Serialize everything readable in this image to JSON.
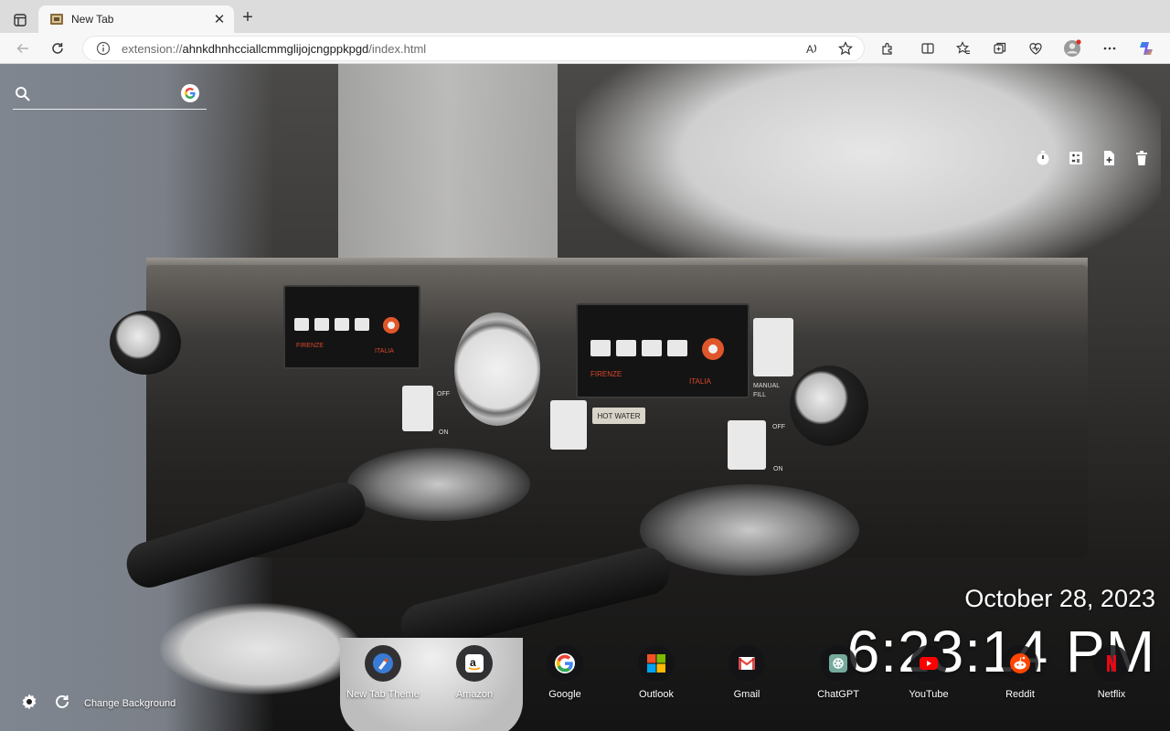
{
  "browser": {
    "tab": {
      "title": "New Tab",
      "close_glyph": "✕",
      "favicon": "newtab-theme-favicon"
    },
    "new_tab_glyph": "+",
    "address": {
      "scheme": "extension://",
      "host": "ahnkdhnhcciallcmmglijojcngppkpgd",
      "path": "/index.html"
    },
    "toolbar_icons": [
      "back-icon",
      "reload-icon",
      "site-info-icon",
      "read-aloud-icon",
      "favorite-star-icon",
      "extensions-icon",
      "split-screen-icon",
      "favorites-icon",
      "collections-icon",
      "browser-essentials-icon",
      "profile-avatar",
      "more-icon",
      "copilot-icon"
    ],
    "accent": "#0b57d0"
  },
  "search": {
    "placeholder": "",
    "value": "",
    "engine": "google-icon"
  },
  "top_tools": [
    "timer-icon",
    "calculator-icon",
    "new-note-icon",
    "trash-icon"
  ],
  "clock": {
    "date": "October 28, 2023",
    "time": "6:23:14 PM"
  },
  "shortcuts": [
    {
      "label": "New Tab Theme",
      "icon": "new-tab-theme-icon"
    },
    {
      "label": "Amazon",
      "icon": "amazon-icon"
    },
    {
      "label": "Google",
      "icon": "google-icon"
    },
    {
      "label": "Outlook",
      "icon": "outlook-icon"
    },
    {
      "label": "Gmail",
      "icon": "gmail-icon"
    },
    {
      "label": "ChatGPT",
      "icon": "chatgpt-icon"
    },
    {
      "label": "YouTube",
      "icon": "youtube-icon"
    },
    {
      "label": "Reddit",
      "icon": "reddit-icon"
    },
    {
      "label": "Netflix",
      "icon": "netflix-icon"
    }
  ],
  "footer": {
    "change_background": "Change Background",
    "icons": [
      "settings-icon",
      "refresh-background-icon"
    ]
  },
  "background_image": {
    "panel_text_left": [
      "FIRENZE",
      "ITALIA"
    ],
    "panel_text_right": [
      "FIRENZE",
      "ITALIA"
    ],
    "label_hot_water": "HOT WATER",
    "label_manual_fill": "MANUAL FILL",
    "switch_off": "OFF",
    "switch_on": "ON"
  }
}
